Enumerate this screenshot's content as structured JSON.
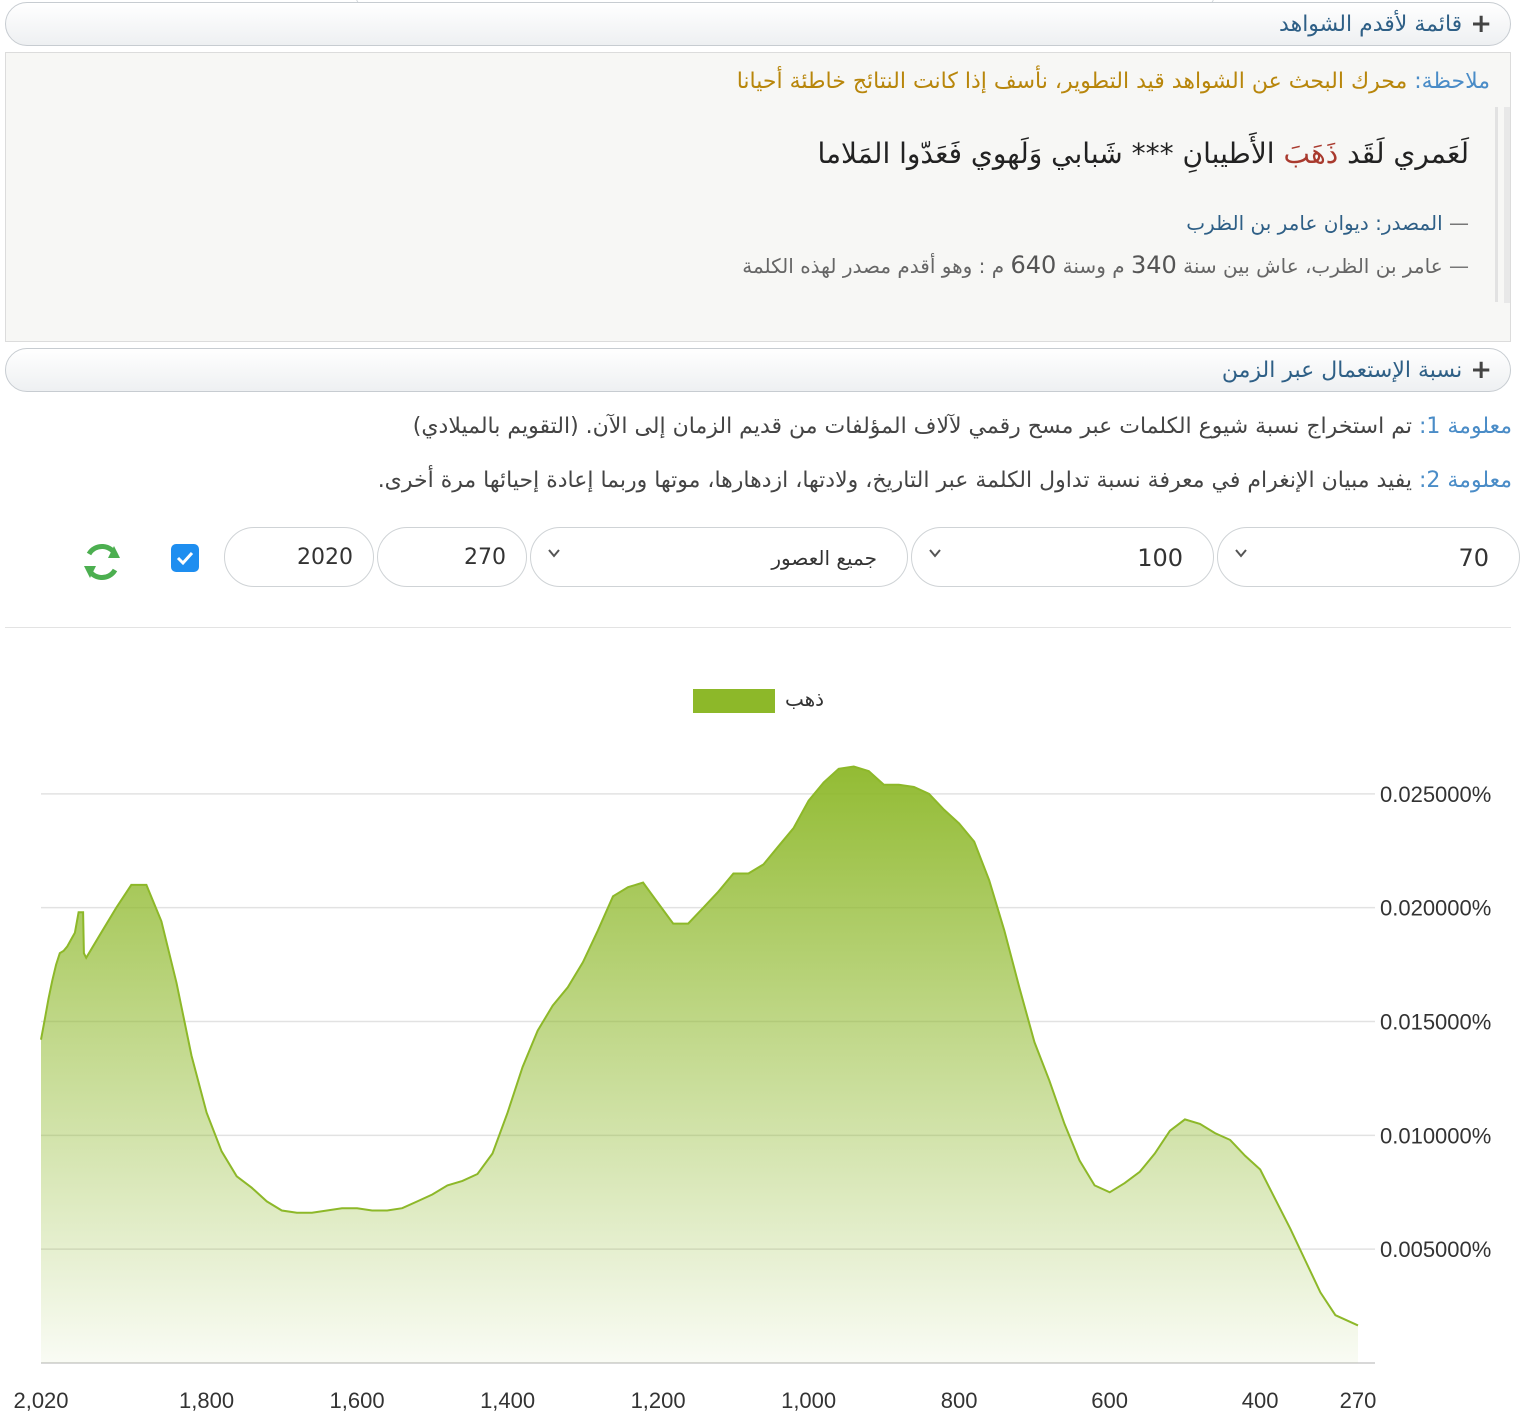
{
  "witnesses_header": {
    "label": "قائمة لأقدم الشواهد",
    "icon": "plus-icon"
  },
  "note": {
    "label": "ملاحظة:",
    "text": " محرك البحث عن الشواهد قيد التطوير، نأسف إذا كانت النتائج خاطئة أحيانا"
  },
  "quote": {
    "verse_before": "لَعَمري لَقَد ",
    "verse_highlight": "ذَهَبَ",
    "verse_after": " الأَطيبانِ *** شَبابي وَلَهوي فَعَدّوا المَلاما",
    "source_label": "المصدر: ديوان عامر بن الظرب",
    "bio_part1": "عامر بن الظرب، عاش بين سنة",
    "bio_year1": "340",
    "bio_part2": "م وسنة",
    "bio_year2": "640",
    "bio_part3": "م : وهو أقدم مصدر لهذه الكلمة"
  },
  "usage_header": {
    "label": "نسبة الإستعمال عبر الزمن",
    "icon": "plus-icon"
  },
  "info1": {
    "label": "معلومة 1:",
    "text": " تم استخراج نسبة شيوع الكلمات عبر مسح رقمي لآلاف المؤلفات من قديم الزمان إلى الآن. (التقويم بالميلادي)"
  },
  "info2": {
    "label": "معلومة 2:",
    "text": " يفيد مبيان الإنغرام في معرفة نسبة تداول الكلمة عبر التاريخ، ولادتها، ازدهارها، موتها وربما إعادة إحيائها مرة أخرى."
  },
  "controls": {
    "smoothing": "70",
    "count": "100",
    "era": "جميع العصور",
    "year_from": "270",
    "year_to": "2020",
    "checkbox_checked": true,
    "refresh_icon": "refresh-icon"
  },
  "colors": {
    "series": "#8db829",
    "link": "#4a8cc7",
    "note": "#b8860b",
    "highlight": "#a93a2e"
  },
  "chart_data": {
    "type": "area",
    "series": [
      {
        "name": "ذهب",
        "points": [
          [
            270,
            0.00165
          ],
          [
            300,
            0.0021
          ],
          [
            320,
            0.0031
          ],
          [
            340,
            0.0045
          ],
          [
            360,
            0.0059
          ],
          [
            380,
            0.0072
          ],
          [
            400,
            0.0085
          ],
          [
            420,
            0.0091
          ],
          [
            440,
            0.0098
          ],
          [
            460,
            0.0101
          ],
          [
            480,
            0.0105
          ],
          [
            500,
            0.0107
          ],
          [
            520,
            0.0102
          ],
          [
            540,
            0.0092
          ],
          [
            560,
            0.0084
          ],
          [
            580,
            0.0079
          ],
          [
            600,
            0.0075
          ],
          [
            620,
            0.0078
          ],
          [
            640,
            0.0089
          ],
          [
            660,
            0.0105
          ],
          [
            680,
            0.0124
          ],
          [
            700,
            0.0141
          ],
          [
            720,
            0.0165
          ],
          [
            740,
            0.019
          ],
          [
            760,
            0.0212
          ],
          [
            780,
            0.0229
          ],
          [
            800,
            0.0237
          ],
          [
            820,
            0.0243
          ],
          [
            840,
            0.025
          ],
          [
            860,
            0.0253
          ],
          [
            880,
            0.0254
          ],
          [
            900,
            0.0254
          ],
          [
            920,
            0.026
          ],
          [
            940,
            0.0262
          ],
          [
            960,
            0.0261
          ],
          [
            980,
            0.0255
          ],
          [
            1000,
            0.0247
          ],
          [
            1020,
            0.0235
          ],
          [
            1040,
            0.0227
          ],
          [
            1060,
            0.0219
          ],
          [
            1080,
            0.0215
          ],
          [
            1100,
            0.0215
          ],
          [
            1120,
            0.0207
          ],
          [
            1140,
            0.02
          ],
          [
            1160,
            0.0193
          ],
          [
            1180,
            0.0193
          ],
          [
            1200,
            0.0202
          ],
          [
            1220,
            0.0211
          ],
          [
            1240,
            0.0209
          ],
          [
            1260,
            0.0205
          ],
          [
            1280,
            0.019
          ],
          [
            1300,
            0.0176
          ],
          [
            1320,
            0.0165
          ],
          [
            1340,
            0.0157
          ],
          [
            1360,
            0.0146
          ],
          [
            1380,
            0.013
          ],
          [
            1400,
            0.011
          ],
          [
            1420,
            0.0092
          ],
          [
            1440,
            0.0083
          ],
          [
            1460,
            0.008
          ],
          [
            1480,
            0.0078
          ],
          [
            1500,
            0.0074
          ],
          [
            1520,
            0.0071
          ],
          [
            1540,
            0.0068
          ],
          [
            1560,
            0.0067
          ],
          [
            1580,
            0.0067
          ],
          [
            1600,
            0.0068
          ],
          [
            1620,
            0.0068
          ],
          [
            1640,
            0.0067
          ],
          [
            1660,
            0.0066
          ],
          [
            1680,
            0.0066
          ],
          [
            1700,
            0.0067
          ],
          [
            1720,
            0.0071
          ],
          [
            1740,
            0.0077
          ],
          [
            1760,
            0.0082
          ],
          [
            1780,
            0.0093
          ],
          [
            1800,
            0.011
          ],
          [
            1820,
            0.0135
          ],
          [
            1840,
            0.0167
          ],
          [
            1860,
            0.0194
          ],
          [
            1880,
            0.021
          ],
          [
            1900,
            0.021
          ],
          [
            1920,
            0.02
          ],
          [
            1940,
            0.0189
          ],
          [
            1960,
            0.0178
          ],
          [
            1963,
            0.018
          ],
          [
            1964,
            0.0198
          ],
          [
            1970,
            0.0198
          ],
          [
            1975,
            0.0189
          ],
          [
            1980,
            0.0186
          ],
          [
            1985,
            0.0183
          ],
          [
            1990,
            0.0181
          ],
          [
            1995,
            0.018
          ],
          [
            2000,
            0.0175
          ],
          [
            2005,
            0.0168
          ],
          [
            2010,
            0.016
          ],
          [
            2015,
            0.0151
          ],
          [
            2020,
            0.0142
          ]
        ]
      }
    ],
    "x_reversed": true,
    "xlim": [
      270,
      2020
    ],
    "ylim": [
      0,
      0.03
    ],
    "x_ticks": [
      "2,020",
      "1,800",
      "1,600",
      "1,400",
      "1,200",
      "1,000",
      "800",
      "600",
      "400",
      "270"
    ],
    "x_tick_values": [
      2020,
      1800,
      1600,
      1400,
      1200,
      1000,
      800,
      600,
      400,
      270
    ],
    "y_ticks": [
      "0.005000%",
      "0.010000%",
      "0.015000%",
      "0.020000%",
      "0.025000%"
    ],
    "y_tick_values": [
      0.005,
      0.01,
      0.015,
      0.02,
      0.025
    ],
    "y_axis_side": "right",
    "grid": true,
    "legend": "top-center"
  }
}
